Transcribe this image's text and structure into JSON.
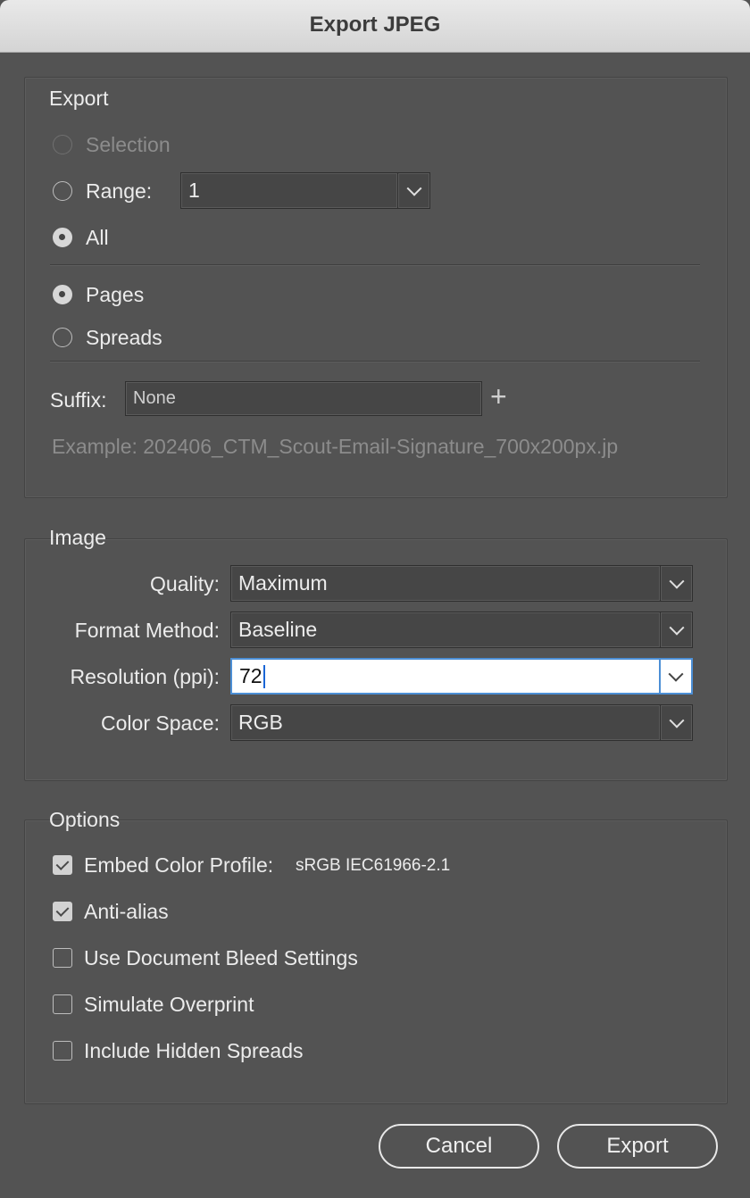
{
  "window": {
    "title": "Export JPEG"
  },
  "export_section": {
    "title": "Export",
    "selection_label": "Selection",
    "range_label": "Range:",
    "range_value": "1",
    "all_label": "All",
    "pages_label": "Pages",
    "spreads_label": "Spreads",
    "suffix_label": "Suffix:",
    "suffix_value": "None",
    "example_text": "Example:  202406_CTM_Scout-Email-Signature_700x200px.jp",
    "selected_scope": "All",
    "selected_layout": "Pages"
  },
  "image_section": {
    "title": "Image",
    "quality_label": "Quality:",
    "quality_value": "Maximum",
    "format_label": "Format Method:",
    "format_value": "Baseline",
    "resolution_label": "Resolution (ppi):",
    "resolution_value": "72",
    "colorspace_label": "Color Space:",
    "colorspace_value": "RGB"
  },
  "options_section": {
    "title": "Options",
    "embed_label": "Embed Color Profile:",
    "embed_profile": "sRGB IEC61966-2.1",
    "embed_checked": true,
    "antialias_label": "Anti-alias",
    "antialias_checked": true,
    "bleed_label": "Use Document Bleed Settings",
    "bleed_checked": false,
    "overprint_label": "Simulate Overprint",
    "overprint_checked": false,
    "hidden_label": "Include Hidden Spreads",
    "hidden_checked": false
  },
  "buttons": {
    "cancel": "Cancel",
    "export": "Export"
  },
  "icons": {
    "dropdown": "chevron-down-icon",
    "add": "plus-icon"
  },
  "colors": {
    "focus": "#4c8fd6",
    "background": "#535353"
  }
}
